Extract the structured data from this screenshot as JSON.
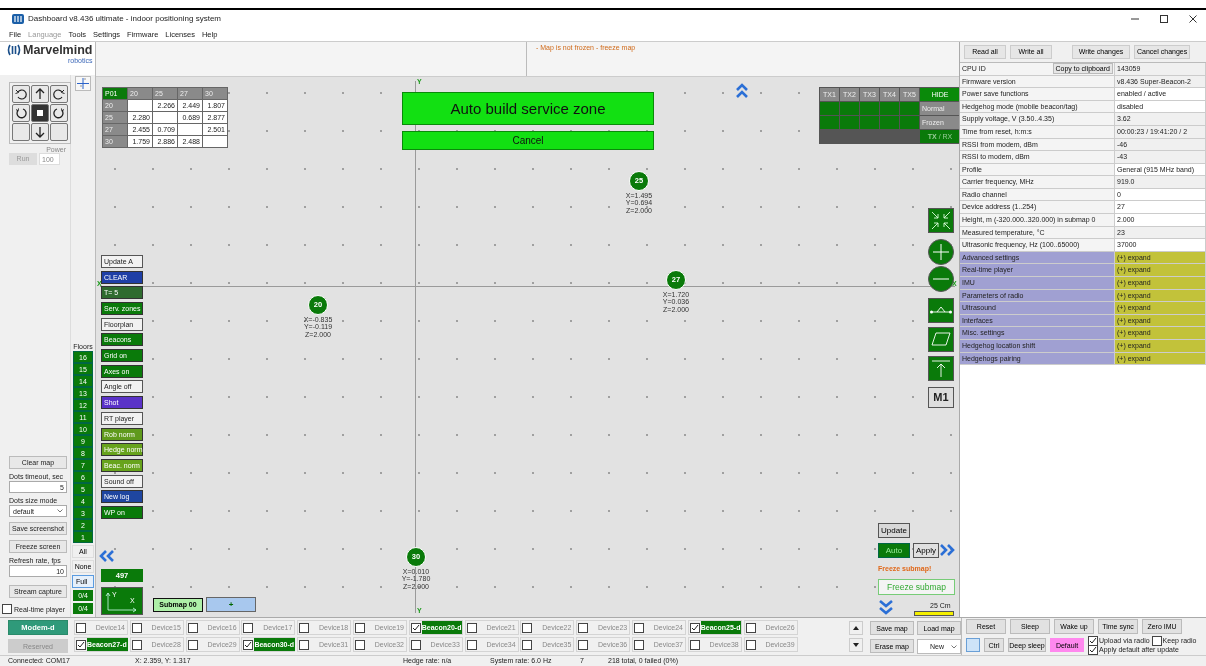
{
  "window": {
    "title": "Dashboard v8.436 ultimate - indoor positioning system"
  },
  "menu": [
    {
      "label": "File",
      "disabled": false
    },
    {
      "label": "Language",
      "disabled": true
    },
    {
      "label": "Tools",
      "disabled": false
    },
    {
      "label": "Settings",
      "disabled": false
    },
    {
      "label": "Firmware",
      "disabled": false
    },
    {
      "label": "Licenses",
      "disabled": false
    },
    {
      "label": "Help",
      "disabled": false
    }
  ],
  "logo": {
    "name": "Marvelmind",
    "tagline": "robotics"
  },
  "control_pad": {
    "power_label": "Power",
    "run": "Run",
    "power": "100"
  },
  "left_panel": {
    "clear_map": "Clear map",
    "dots_timeout_label": "Dots timeout, sec",
    "dots_timeout": "5",
    "dots_size_label": "Dots size mode",
    "dots_size": "default",
    "save_screenshot": "Save screenshot",
    "freeze_screen": "Freeze screen",
    "refresh_label": "Refresh rate, fps",
    "refresh": "10",
    "stream_capture": "Stream capture",
    "realtime_player": {
      "label": "Real-time player",
      "checked": false
    }
  },
  "floors": {
    "label": "Floors",
    "items": [
      "16",
      "15",
      "14",
      "13",
      "12",
      "11",
      "10",
      "9",
      "8",
      "7",
      "6",
      "5",
      "4",
      "3",
      "2",
      "1"
    ],
    "buttons": [
      {
        "label": "All",
        "selected": false
      },
      {
        "label": "None",
        "selected": false
      },
      {
        "label": "Full",
        "selected": true
      }
    ],
    "counts": [
      "0/4",
      "0/4"
    ]
  },
  "map": {
    "status": "- Map is not frozen - freeze map",
    "distance_table": {
      "columns": [
        "P01",
        "20",
        "25",
        "27",
        "30"
      ],
      "rows": [
        [
          "20",
          null,
          "2.266",
          "2.449",
          "1.807"
        ],
        [
          "25",
          "2.280",
          null,
          "0.689",
          "2.877"
        ],
        [
          "27",
          "2.455",
          "0.709",
          null,
          "2.501"
        ],
        [
          "30",
          "1.759",
          "2.886",
          "2.488",
          null
        ]
      ]
    },
    "service_zone": {
      "title": "Auto build service zone",
      "cancel": "Cancel"
    },
    "tx_table": {
      "columns": [
        "TX1",
        "TX2",
        "TX3",
        "TX4",
        "TX5"
      ],
      "hide": "HIDE",
      "modes": [
        "Normal",
        "Frozen"
      ],
      "toggle": "**TX** / RX"
    },
    "axes": {
      "y_top": "Y",
      "y_bottom": "Y",
      "x_left": "X",
      "x_right": "X"
    },
    "beacons": [
      {
        "id": "25",
        "x": "X=1.495",
        "y": "Y=0.694",
        "z": "Z=2.000"
      },
      {
        "id": "27",
        "x": "X=1.720",
        "y": "Y=0.036",
        "z": "Z=2.000"
      },
      {
        "id": "20",
        "x": "X=-0.835",
        "y": "Y=-0.119",
        "z": "Z=2.000"
      },
      {
        "id": "30",
        "x": "X=0.010",
        "y": "Y=-1.780",
        "z": "Z=2.000"
      }
    ],
    "buttons": [
      {
        "label": "Update A",
        "color": "#f2f2f2"
      },
      {
        "label": "CLEAR",
        "color": "#1f3fa6"
      },
      {
        "label": "T= 5",
        "color": "#2f6b2f"
      },
      {
        "label": "Serv. zones",
        "color": "#0a7a0a"
      },
      {
        "label": "Floorplan",
        "color": "#f2f2f2"
      },
      {
        "label": "Beacons",
        "color": "#0a7a0a"
      },
      {
        "label": "Grid on",
        "color": "#0a7a0a"
      },
      {
        "label": "Axes on",
        "color": "#0a7a0a"
      },
      {
        "label": "Angle off",
        "color": "#f2f2f2"
      },
      {
        "label": "Shot",
        "color": "#5a32c8"
      },
      {
        "label": "RT player",
        "color": "#f2f2f2"
      },
      {
        "label": "Rob norm",
        "color": "#5f9a1c"
      },
      {
        "label": "Hedge norm",
        "color": "#67a31c"
      },
      {
        "label": "Beac. norm",
        "color": "#67a31c"
      },
      {
        "label": "Sound off",
        "color": "#f2f2f2"
      },
      {
        "label": "New log",
        "color": "#1f46a0"
      },
      {
        "label": "WP on",
        "color": "#0a7a0a"
      }
    ],
    "counter": "497",
    "axis_button": {
      "y": "Y",
      "x": "X"
    },
    "submap": {
      "label": "Submap 00",
      "add": "+"
    },
    "m1": "M1",
    "submap_controls": {
      "update": "Update",
      "auto": {
        "label": "Auto",
        "on": true
      },
      "apply": "Apply",
      "warning": "Freeze submap!",
      "freeze": "Freeze submap",
      "scale": "25 Cm"
    }
  },
  "right_panel": {
    "buttons": [
      "Read all",
      "Write all",
      "Write changes",
      "Cancel changes"
    ],
    "copy": "Copy to clipboard",
    "rows": [
      {
        "label": "CPU ID",
        "value": "143059",
        "editable": false
      },
      {
        "label": "Firmware version",
        "value": "v8.436 Super-Beacon-2",
        "editable": false
      },
      {
        "label": "Power save functions",
        "value": "enabled / active",
        "editable": true
      },
      {
        "label": "Hedgehog mode (mobile beacon/tag)",
        "value": "disabled",
        "editable": true
      },
      {
        "label": "Supply voltage, V (3.50..4.35)",
        "value": "3.62",
        "editable": false
      },
      {
        "label": "Time from reset, h:m:s",
        "value": "00:00:23 / 19:41:20 / 2",
        "editable": false
      },
      {
        "label": "RSSI from modem, dBm",
        "value": "-46",
        "editable": false
      },
      {
        "label": "RSSI to modem, dBm",
        "value": "-43",
        "editable": false
      },
      {
        "label": "Profile",
        "value": "General (915 MHz band)",
        "editable": true
      },
      {
        "label": "Carrier frequency, MHz",
        "value": "919.0",
        "editable": false
      },
      {
        "label": "Radio channel",
        "value": "0",
        "editable": true
      },
      {
        "label": "Device address (1..254)",
        "value": "27",
        "editable": true
      },
      {
        "label": "Height, m (-320.000..320.000) in submap 0",
        "value": "2.000",
        "editable": true
      },
      {
        "label": "Measured temperature, °C",
        "value": "23",
        "editable": false
      },
      {
        "label": "Ultrasonic frequency, Hz (100..65000)",
        "value": "37000",
        "editable": true
      }
    ],
    "sections": [
      {
        "label": "Advanced settings",
        "value": "(+) expand"
      },
      {
        "label": "Real-time player",
        "value": "(+) expand"
      },
      {
        "label": "IMU",
        "value": "(+) expand"
      },
      {
        "label": "Parameters of radio",
        "value": "(+) expand"
      },
      {
        "label": "Ultrasound",
        "value": "(+) expand"
      },
      {
        "label": "Interfaces",
        "value": "(+) expand"
      },
      {
        "label": "Misc. settings",
        "value": "(+) expand"
      },
      {
        "label": "Hedgehog location shift",
        "value": "(+) expand"
      },
      {
        "label": "Hedgehogs pairing",
        "value": "(+) expand"
      }
    ]
  },
  "modem": {
    "label": "Modem-d",
    "reserved": "Reserved"
  },
  "devices": [
    [
      {
        "label": "Device14",
        "checked": false
      },
      {
        "label": "Device15",
        "checked": false
      },
      {
        "label": "Device16",
        "checked": false
      },
      {
        "label": "Device17",
        "checked": false
      },
      {
        "label": "Device18",
        "checked": false
      },
      {
        "label": "Device19",
        "checked": false
      },
      {
        "label": "Beacon20-d",
        "checked": true
      },
      {
        "label": "Device21",
        "checked": false
      },
      {
        "label": "Device22",
        "checked": false
      },
      {
        "label": "Device23",
        "checked": false
      },
      {
        "label": "Device24",
        "checked": false
      },
      {
        "label": "Beacon25-d",
        "checked": true
      },
      {
        "label": "Device26",
        "checked": false
      }
    ],
    [
      {
        "label": "Beacon27-d",
        "checked": true
      },
      {
        "label": "Device28",
        "checked": false
      },
      {
        "label": "Device29",
        "checked": false
      },
      {
        "label": "Beacon30-d",
        "checked": true
      },
      {
        "label": "Device31",
        "checked": false
      },
      {
        "label": "Device32",
        "checked": false
      },
      {
        "label": "Device33",
        "checked": false
      },
      {
        "label": "Device34",
        "checked": false
      },
      {
        "label": "Device35",
        "checked": false
      },
      {
        "label": "Device36",
        "checked": false
      },
      {
        "label": "Device37",
        "checked": false
      },
      {
        "label": "Device38",
        "checked": false
      },
      {
        "label": "Device39",
        "checked": false
      }
    ]
  ],
  "map_files": {
    "save": "Save map",
    "load": "Load map",
    "erase": "Erase map",
    "select": "New"
  },
  "commands": {
    "buttons": [
      "Reset",
      "Sleep",
      "Wake up",
      "Time sync",
      "Zero IMU"
    ],
    "ctrl": "Ctrl",
    "deep_sleep": "Deep sleep",
    "default": "Default",
    "options": [
      {
        "label": "Upload via radio",
        "checked": true
      },
      {
        "label": "Keep radio",
        "checked": false
      },
      {
        "label": "Apply default after update",
        "checked": true
      }
    ]
  },
  "status_bar": [
    "Connected: COM17",
    "X: 2.359, Y: 1.317",
    "Hedge rate: n/a",
    "System rate: 6.0 Hz",
    "7",
    "218 total, 0 failed (0%)"
  ]
}
